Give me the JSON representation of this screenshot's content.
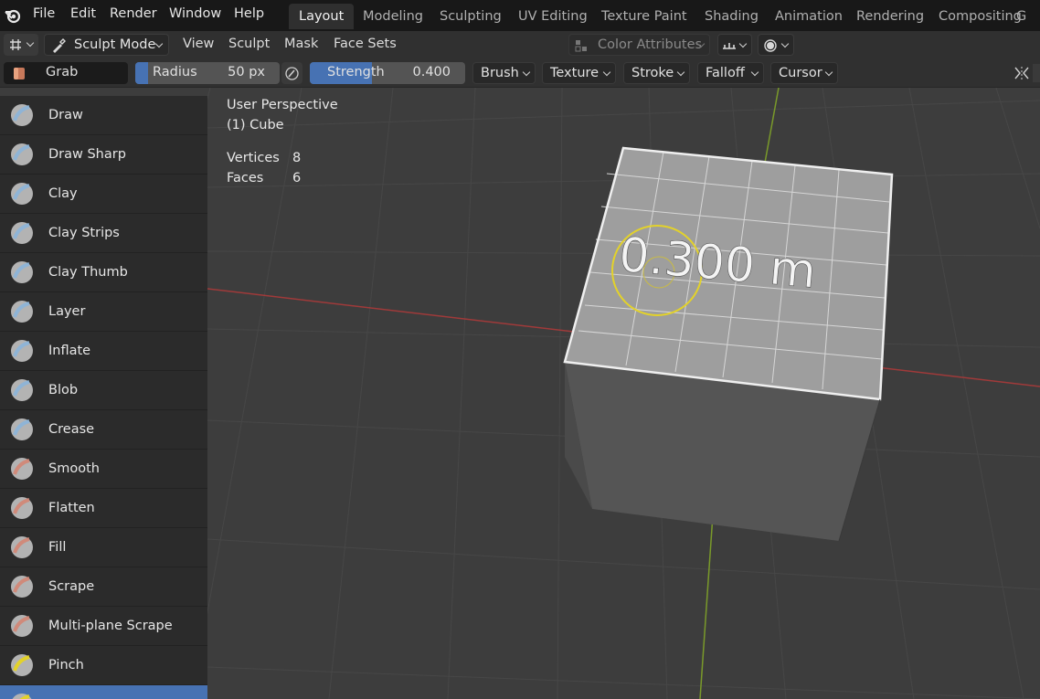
{
  "menubar": {
    "items": [
      "File",
      "Edit",
      "Render",
      "Window",
      "Help"
    ]
  },
  "workspaces": {
    "tabs": [
      "Layout",
      "Modeling",
      "Sculpting",
      "UV Editing",
      "Texture Paint",
      "Shading",
      "Animation",
      "Rendering",
      "Compositing",
      "G"
    ],
    "active": "Layout"
  },
  "header": {
    "mode": "Sculpt Mode",
    "menus": [
      "View",
      "Sculpt",
      "Mask",
      "Face Sets"
    ],
    "color_attributes": "Color Attributes"
  },
  "toolsettings": {
    "brush_name": "Grab",
    "radius_label": "Radius",
    "radius_value": "50 px",
    "strength_label": "Strength",
    "strength_value": "0.400",
    "strength_fraction": 0.4,
    "dropdowns": [
      "Brush",
      "Texture",
      "Stroke",
      "Falloff",
      "Cursor"
    ]
  },
  "toolbar": {
    "items": [
      {
        "label": "Draw",
        "icon": "draw-brush-icon"
      },
      {
        "label": "Draw Sharp",
        "icon": "draw-sharp-brush-icon"
      },
      {
        "label": "Clay",
        "icon": "clay-brush-icon"
      },
      {
        "label": "Clay Strips",
        "icon": "clay-strips-brush-icon"
      },
      {
        "label": "Clay Thumb",
        "icon": "clay-thumb-brush-icon"
      },
      {
        "label": "Layer",
        "icon": "layer-brush-icon"
      },
      {
        "label": "Inflate",
        "icon": "inflate-brush-icon"
      },
      {
        "label": "Blob",
        "icon": "blob-brush-icon"
      },
      {
        "label": "Crease",
        "icon": "crease-brush-icon"
      },
      {
        "label": "Smooth",
        "icon": "smooth-brush-icon"
      },
      {
        "label": "Flatten",
        "icon": "flatten-brush-icon"
      },
      {
        "label": "Fill",
        "icon": "fill-brush-icon"
      },
      {
        "label": "Scrape",
        "icon": "scrape-brush-icon"
      },
      {
        "label": "Multi-plane Scrape",
        "icon": "multiplane-scrape-brush-icon"
      },
      {
        "label": "Pinch",
        "icon": "pinch-brush-icon"
      },
      {
        "label": "",
        "icon": "grab-brush-icon"
      }
    ],
    "active_index": 15
  },
  "viewport": {
    "perspective": "User Perspective",
    "object": "(1) Cube",
    "stats": [
      {
        "label": "Vertices",
        "value": "8"
      },
      {
        "label": "Faces",
        "value": "6"
      }
    ],
    "measurement": "0.300 m"
  },
  "colors": {
    "accent": "#4772b3",
    "viewport_bg": "#3d3d3d",
    "x_axis": "#a03a3a",
    "y_axis": "#7a9a2a",
    "brush_cursor": "#e3d22a"
  }
}
